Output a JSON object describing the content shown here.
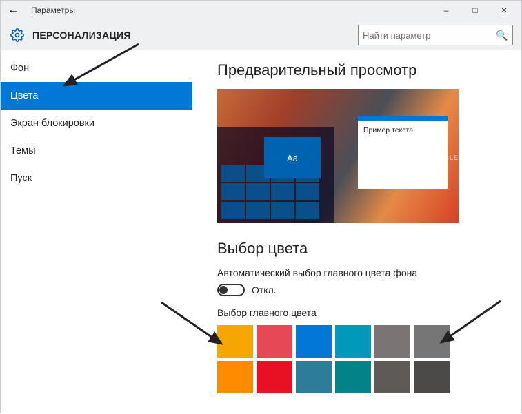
{
  "titlebar": {
    "title": "Параметры"
  },
  "header": {
    "section": "ПЕРСОНАЛИЗАЦИЯ",
    "search_placeholder": "Найти параметр"
  },
  "sidebar": {
    "items": [
      {
        "label": "Фон",
        "active": false
      },
      {
        "label": "Цвета",
        "active": true
      },
      {
        "label": "Экран блокировки",
        "active": false
      },
      {
        "label": "Темы",
        "active": false
      },
      {
        "label": "Пуск",
        "active": false
      }
    ]
  },
  "main": {
    "preview_heading": "Предварительный просмотр",
    "sample_tile_text": "Aa",
    "sample_window_text": "Пример текста",
    "watermark": "DIBLE",
    "choose_heading": "Выбор цвета",
    "auto_label": "Автоматический выбор главного цвета фона",
    "toggle_state_label": "Откл.",
    "toggle_on": false,
    "main_color_label": "Выбор главного цвета",
    "swatches_row1": [
      "#f7a500",
      "#e74856",
      "#0078d7",
      "#0099bc",
      "#7a7574",
      "#767676"
    ],
    "swatches_row2": [
      "#ff8c00",
      "#e81123",
      "#2d7d9a",
      "#038387",
      "#5d5a58",
      "#4c4a48"
    ]
  }
}
